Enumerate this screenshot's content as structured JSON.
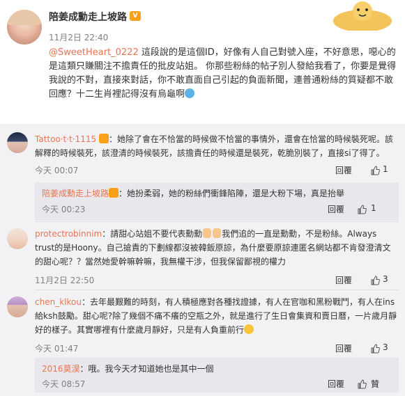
{
  "post": {
    "author": "陪姜成勳走上坡路",
    "time": "11月2日 22:40",
    "mention": "@SweetHeart_0222",
    "body": "這段說的是這個ID，好像有人自己對號入座，不好意思，噁心的是這類只賺關注不擔責任的批皮站姐。 你那些粉絲的帖子別人發給我看了，你要是覺得我說的不對，直接來對話，你不敢直面自己引起的負面新聞，連普通粉絲的質疑都不敢回應？十二生肖裡記得沒有烏龜啊"
  },
  "comments": [
    {
      "user": "Tattoo·t·t·1115",
      "text": "：她除了會在不恰當的時候做不恰當的事情外，還會在恰當的時候裝死呢。該解釋的時候裝死，該澄清的時候裝死，該擔責任的時候還是裝死，乾脆別裝了，直接si了得了。",
      "time": "今天 00:07",
      "reply_label": "回覆",
      "likes": "1",
      "reply": {
        "user": "陪姜成勳走上坡路",
        "text": "：她扮柔弱，她的粉絲們衝鋒陷陣，還是大粉下場，真是抬舉",
        "time": "今天 00:23",
        "reply_label": "回覆",
        "likes": "1"
      }
    },
    {
      "user": "protectrobinnim",
      "text_a": "：請甜心站姐不要代表勳勳",
      "text_b": "我們追的一直是勳勳，不是粉絲。Always trust的是Hoony。自己搶責的下劃線都沒被韓飯原諒，為什麼要原諒連匿名網站都不肯發澄清文的甜心呢？？當然她愛幹嘛幹嘛，我無權干涉，但我保留鄙視的權力",
      "time": "11月2日 22:50",
      "reply_label": "回覆",
      "likes": "3"
    },
    {
      "user": "chen_klkou",
      "text": "：去年最艱難的時刻，有人積極應對各種找證據，有人在官咖和黑粉戰鬥，有人在ins給ksh鼓勵。甜心呢?除了幾個不痛不癢的空瓶之外，就是進行了生日會集資和賣日曆，一片歲月靜好的樣子。其實哪裡有什麼歲月靜好，只是有人負重前行",
      "time": "今天 01:47",
      "reply_label": "回覆",
      "likes": "3",
      "reply": {
        "user": "2016莫淏",
        "text": "：哦。我今天才知道她也是其中一個",
        "time": "今天 08:57",
        "reply_label": "回覆",
        "likes": "贊"
      }
    }
  ]
}
